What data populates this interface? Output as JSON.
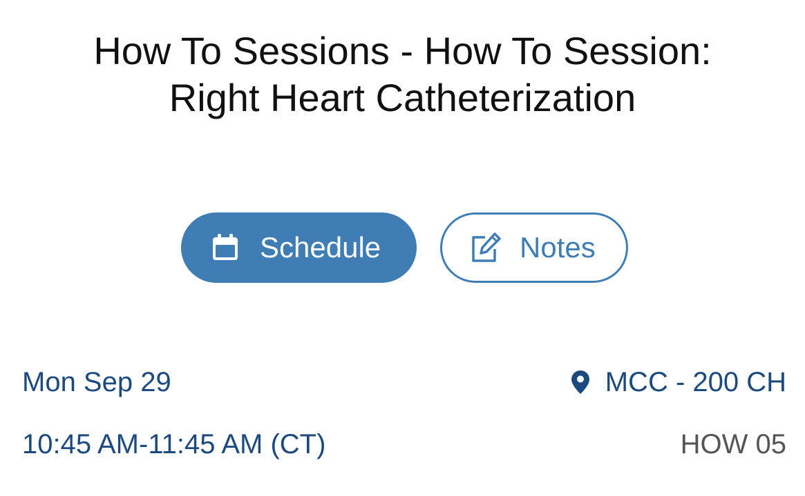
{
  "session": {
    "title_line1": "How To Sessions - How To Session:",
    "title_line2": "Right Heart Catheterization",
    "date": "Mon Sep 29",
    "time": "10:45 AM-11:45 AM (CT)",
    "location": "MCC - 200 CH",
    "code": "HOW 05"
  },
  "actions": {
    "schedule_label": "Schedule",
    "schedule_icon": "calendar-icon",
    "notes_label": "Notes",
    "notes_icon": "edit-note-icon"
  },
  "icons": {
    "location": "map-pin-icon"
  },
  "colors": {
    "accent": "#3f7db4",
    "info_text": "#1d4a7e",
    "code_text": "#555555",
    "title_text": "#111111"
  }
}
